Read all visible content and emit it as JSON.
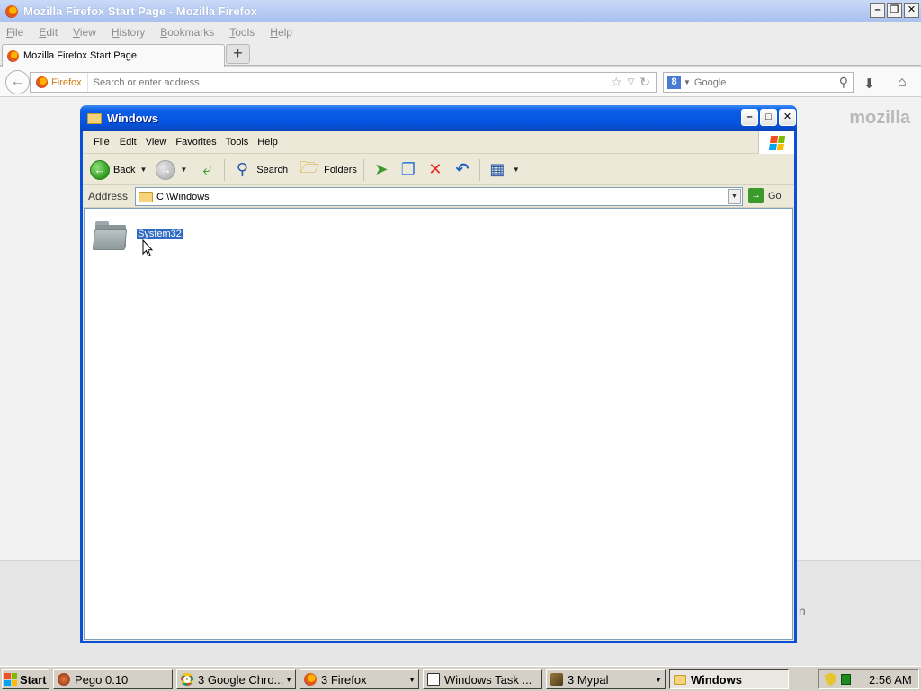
{
  "firefox": {
    "window_title": "Mozilla Firefox Start Page - Mozilla Firefox",
    "menu": [
      "File",
      "Edit",
      "View",
      "History",
      "Bookmarks",
      "Tools",
      "Help"
    ],
    "tab_title": "Mozilla Firefox Start Page",
    "new_tab_label": "+",
    "identity_label": "Firefox",
    "url_placeholder": "Search or enter address",
    "search_engine": "8",
    "search_placeholder": "Google",
    "brand_text": "mozilla",
    "peek_text": "n"
  },
  "explorer": {
    "window_title": "Windows",
    "menu": [
      "File",
      "Edit",
      "View",
      "Favorites",
      "Tools",
      "Help"
    ],
    "toolbar": {
      "back_label": "Back",
      "search_label": "Search",
      "folders_label": "Folders"
    },
    "address_label": "Address",
    "address_value": "C:\\Windows",
    "go_label": "Go",
    "items": [
      {
        "name": "System32",
        "selected": true
      }
    ]
  },
  "taskbar": {
    "start_label": "Start",
    "buttons": [
      {
        "label": "Pego 0.10",
        "icon": "pego-icon",
        "active": false,
        "has_arrow": false
      },
      {
        "label": "3 Google Chro...",
        "icon": "chrome-icon",
        "active": false,
        "has_arrow": true
      },
      {
        "label": "3 Firefox",
        "icon": "firefox-icon",
        "active": false,
        "has_arrow": true
      },
      {
        "label": "Windows Task ...",
        "icon": "task-manager-icon",
        "active": false,
        "has_arrow": false
      },
      {
        "label": "3 Mypal",
        "icon": "mypal-icon",
        "active": false,
        "has_arrow": true
      },
      {
        "label": "Windows",
        "icon": "folder-icon",
        "active": true,
        "has_arrow": false
      }
    ],
    "clock": "2:56 AM"
  }
}
